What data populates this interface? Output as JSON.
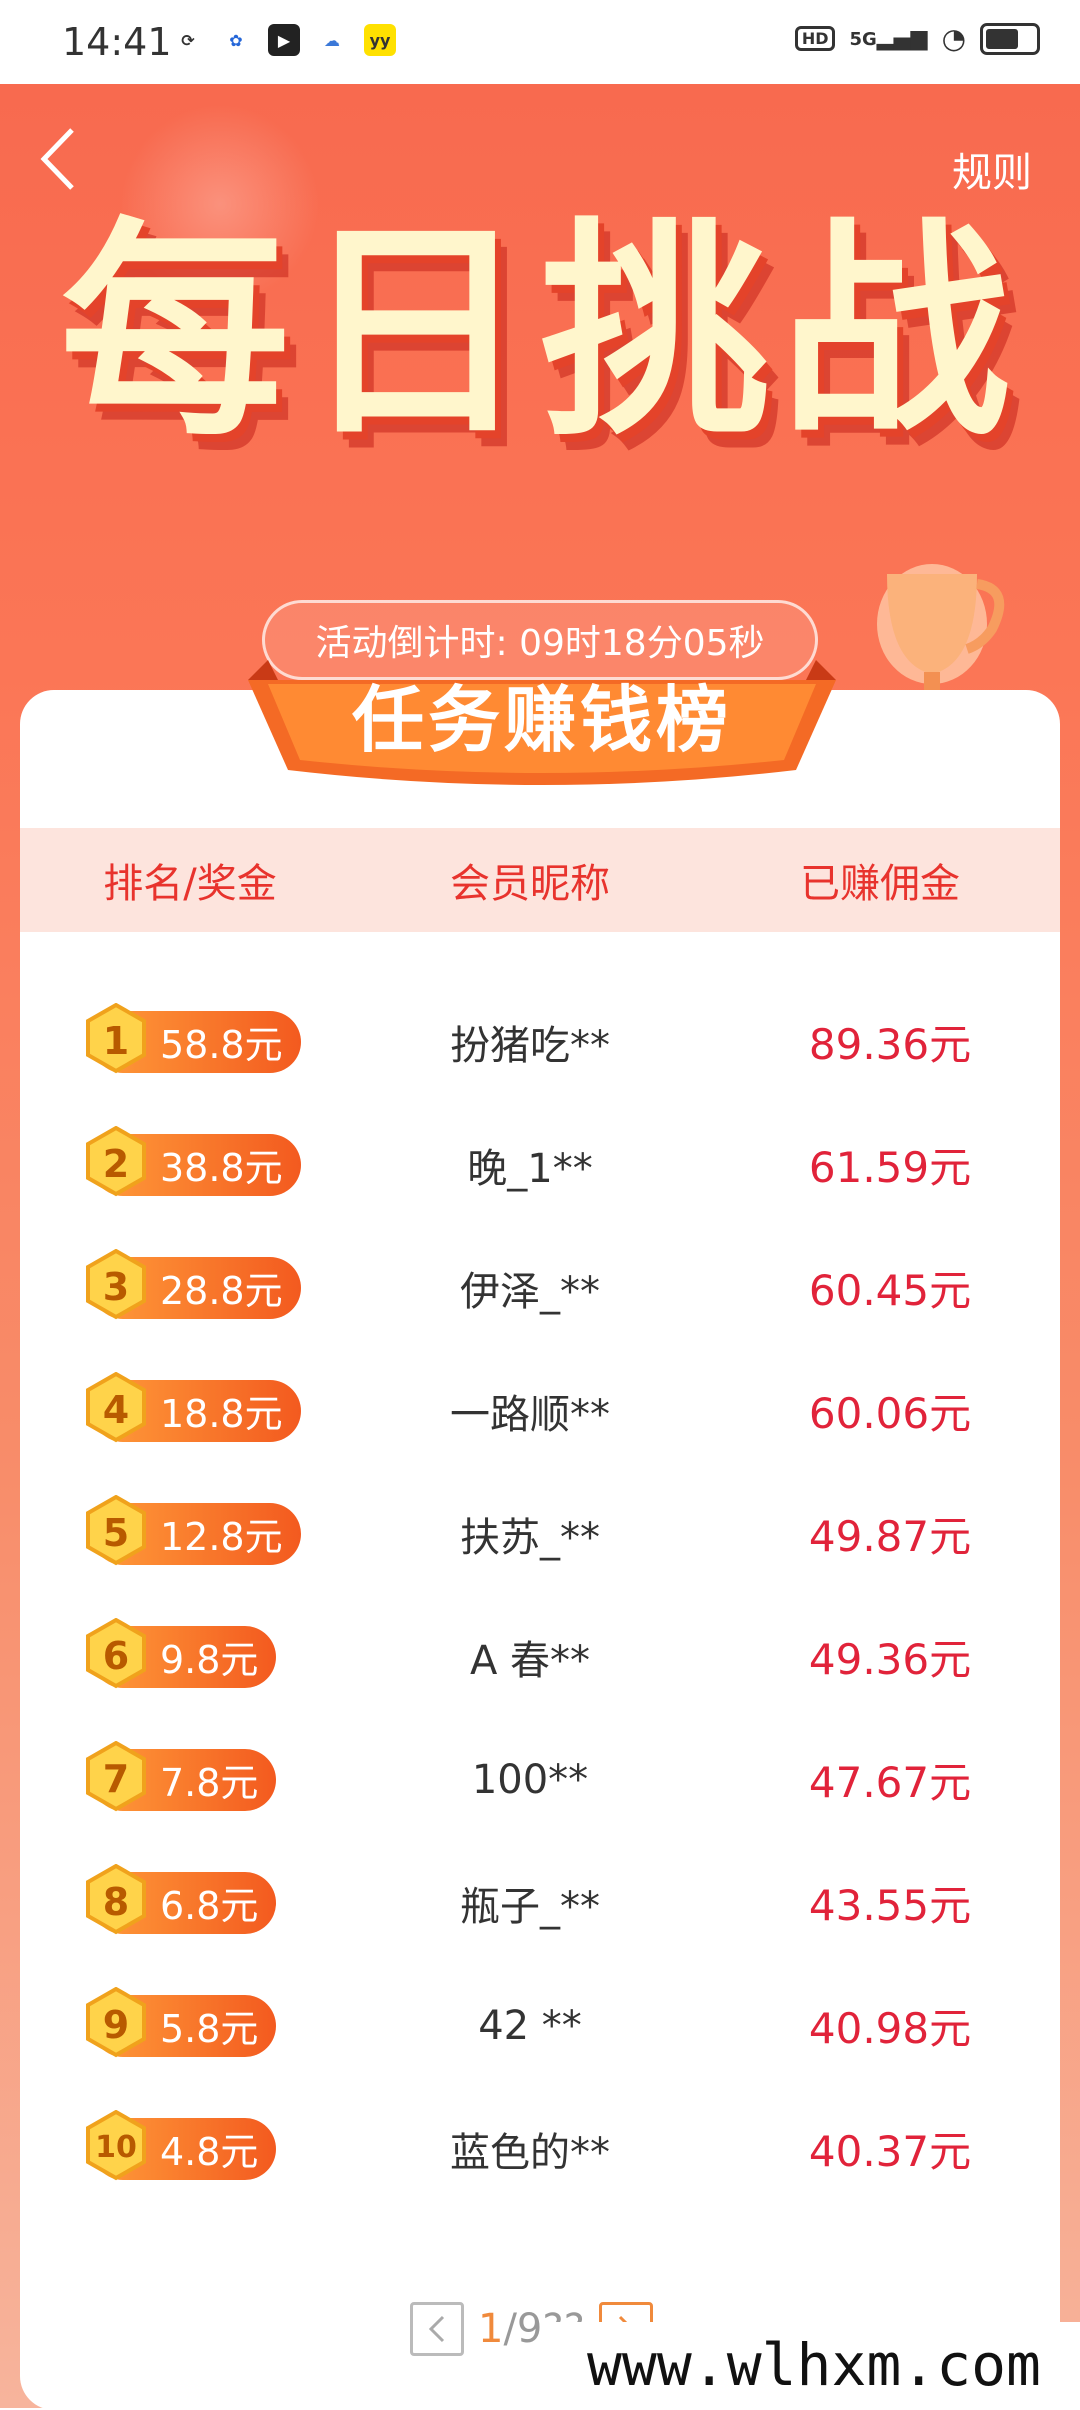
{
  "status_bar": {
    "time": "14:41",
    "app_icons": [
      "sync-icon",
      "baidu-icon",
      "video-play-icon",
      "bot-icon",
      "yy-icon"
    ],
    "hd": "HD",
    "signal": "5G",
    "battery_level": 0.6
  },
  "header": {
    "back_icon": "chevron-left-icon",
    "rules_label": "规则",
    "title": "每日挑战",
    "countdown_text": "活动倒计时: 09时18分05秒"
  },
  "board": {
    "title": "任务赚钱榜",
    "columns": [
      "排名/奖金",
      "会员昵称",
      "已赚佣金"
    ],
    "rows": [
      {
        "rank": "1",
        "prize": "58.8元",
        "name": "扮猪吃**",
        "earned": "89.36元"
      },
      {
        "rank": "2",
        "prize": "38.8元",
        "name": "晚_1**",
        "earned": "61.59元"
      },
      {
        "rank": "3",
        "prize": "28.8元",
        "name": "伊泽_**",
        "earned": "60.45元"
      },
      {
        "rank": "4",
        "prize": "18.8元",
        "name": "一路顺**",
        "earned": "60.06元"
      },
      {
        "rank": "5",
        "prize": "12.8元",
        "name": "扶苏_**",
        "earned": "49.87元"
      },
      {
        "rank": "6",
        "prize": "9.8元",
        "name": "A 春**",
        "earned": "49.36元"
      },
      {
        "rank": "7",
        "prize": "7.8元",
        "name": "100**",
        "earned": "47.67元"
      },
      {
        "rank": "8",
        "prize": "6.8元",
        "name": "瓶子_**",
        "earned": "43.55元"
      },
      {
        "rank": "9",
        "prize": "5.8元",
        "name": "42 **",
        "earned": "40.98元"
      },
      {
        "rank": "10",
        "prize": "4.8元",
        "name": "蓝色的**",
        "earned": "40.37元"
      }
    ]
  },
  "pager": {
    "current": "1",
    "total": "/9??",
    "prev_icon": "chevron-left-icon",
    "next_icon": "chevron-right-icon"
  },
  "watermark": "www.wlhxm.com",
  "colors": {
    "accent_red": "#e1233a",
    "header_bg": "#f86a4f",
    "pill_orange": "#f35a1f",
    "table_head_bg": "#fde4dd"
  }
}
